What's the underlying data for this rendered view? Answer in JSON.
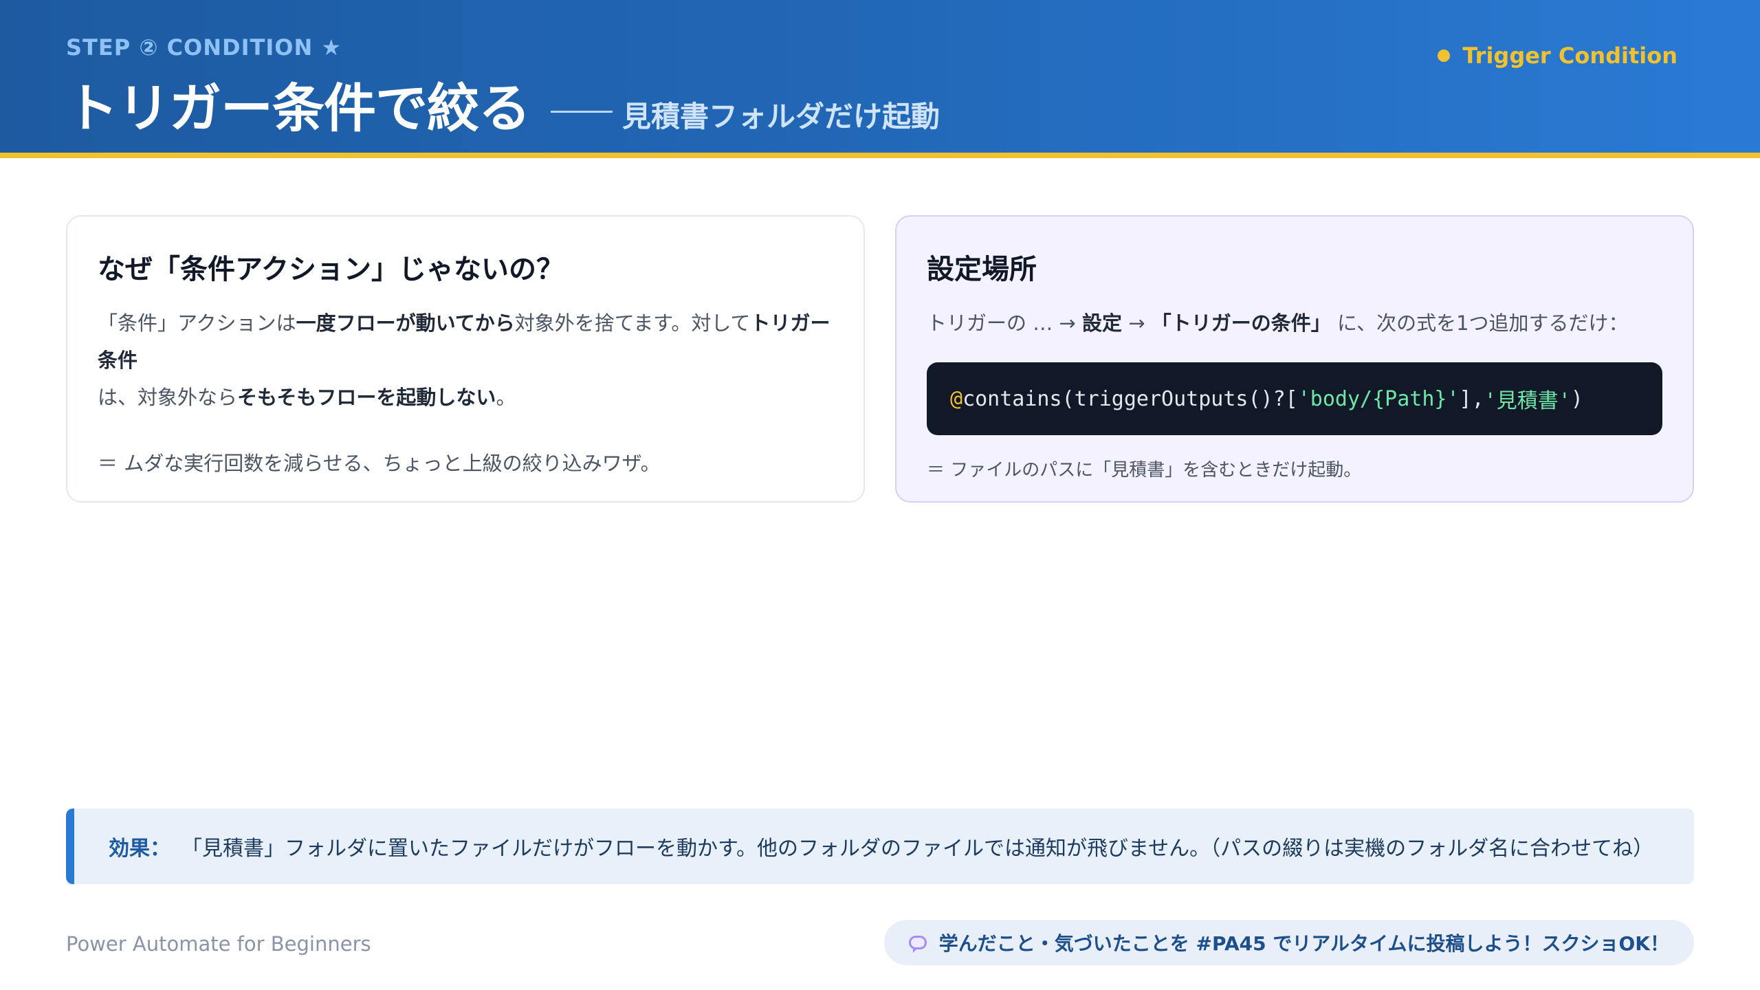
{
  "header": {
    "step_label": "STEP ② CONDITION ★",
    "title": "トリガー条件で絞る",
    "subtitle": "見積書フォルダだけ起動",
    "badge": "Trigger Condition"
  },
  "left_card": {
    "title": "なぜ「条件アクション」じゃないの？",
    "p1_a": "「条件」アクションは",
    "p1_b": "一度フローが動いてから",
    "p1_c": "対象外を捨てます。対して",
    "p1_d": "トリガー条件",
    "p1_e": "は、対象外なら",
    "p1_f": "そもそもフローを起動しない",
    "p1_g": "。",
    "note": "＝ ムダな実行回数を減らせる、ちょっと上級の絞り込みワザ。"
  },
  "right_card": {
    "title": "設定場所",
    "path_a": "トリガーの … → ",
    "path_b": "設定",
    "path_c": " → ",
    "path_d": "「トリガーの条件」",
    "path_e": " に、次の式を1つ追加するだけ：",
    "code_at": "@",
    "code_a": "contains(triggerOutputs()?[",
    "code_s1": "'body/{Path}'",
    "code_b": "],",
    "code_s2": "'見積書'",
    "code_c": ")",
    "code_note": "＝ ファイルのパスに「見積書」を含むときだけ起動。"
  },
  "effect": {
    "label": "効果：",
    "text": "「見積書」フォルダに置いたファイルだけがフローを動かす。他のフォルダのファイルでは通知が飛びません。（パスの綴りは実機のフォルダ名に合わせてね）"
  },
  "footer": {
    "left": "Power Automate for Beginners",
    "pill": "学んだこと・気づいたことを #PA45 でリアルタイムに投稿しよう！スクショOK！",
    "pill_icon": "speech-bubble-icon"
  },
  "colors": {
    "header_start": "#1d5aa0",
    "header_end": "#2a7ad4",
    "accent": "#f2c12e",
    "code_bg": "#111827",
    "code_string": "#6ee7a7"
  }
}
